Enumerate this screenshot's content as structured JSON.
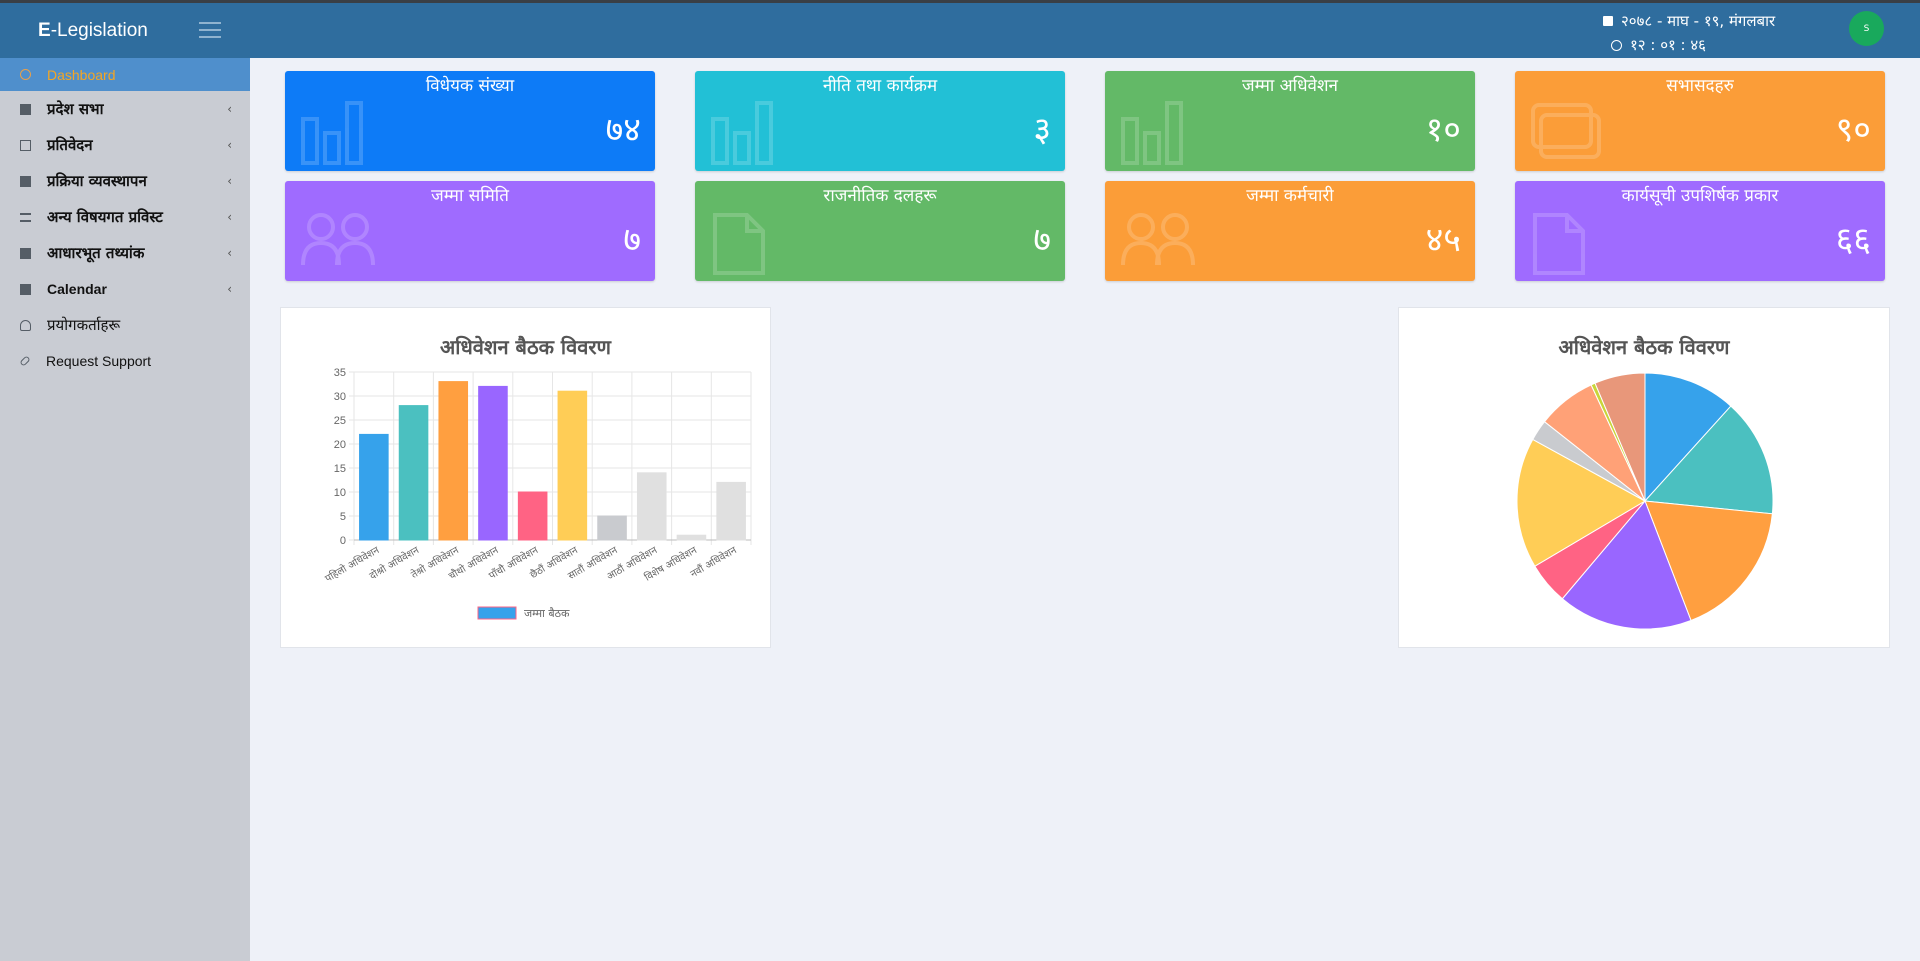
{
  "app": {
    "brand_prefix": "E",
    "brand_rest": "-Legislation"
  },
  "topbar": {
    "date": "२०७८ - माघ - १९, मंगलबार",
    "time": "१२ : ०१ : ४६",
    "user_initial": "S"
  },
  "sidebar": {
    "items": [
      {
        "label": "Dashboard",
        "icon": "dashboard-icon"
      },
      {
        "label": "प्रदेश सभा",
        "icon": "square-icon"
      },
      {
        "label": "प्रतिवेदन",
        "icon": "book-icon"
      },
      {
        "label": "प्रक्रिया व्यवस्थापन",
        "icon": "square-icon"
      },
      {
        "label": "अन्य विषयगत प्रविस्ट",
        "icon": "list-icon"
      },
      {
        "label": "आधारभूत तथ्यांक",
        "icon": "square-icon"
      },
      {
        "label": "Calendar",
        "icon": "square-icon"
      },
      {
        "label": "प्रयोगकर्ताहरू",
        "icon": "user-icon"
      },
      {
        "label": "Request Support",
        "icon": "link-icon"
      }
    ]
  },
  "cards": [
    {
      "title": "विधेयक संख्या",
      "value": "७४",
      "color": "#0d7bf7",
      "icon": "bar-chart-icon"
    },
    {
      "title": "नीति तथा कार्यक्रम",
      "value": "३",
      "color": "#22c0d6",
      "icon": "bar-chart-icon"
    },
    {
      "title": "जम्मा अधिवेशन",
      "value": "१०",
      "color": "#63b967",
      "icon": "bar-chart-icon"
    },
    {
      "title": "सभासदहरु",
      "value": "९०",
      "color": "#fb9d38",
      "icon": "folder-icon"
    },
    {
      "title": "जम्मा समिति",
      "value": "७",
      "color": "#9f6bff",
      "icon": "users-icon"
    },
    {
      "title": "राजनीतिक दलहरू",
      "value": "७",
      "color": "#63b967",
      "icon": "file-icon"
    },
    {
      "title": "जम्मा कर्मचारी",
      "value": "४५",
      "color": "#fb9d38",
      "icon": "users-icon"
    },
    {
      "title": "कार्यसूची उपशिर्षक प्रकार",
      "value": "६६",
      "color": "#9f6bff",
      "icon": "file-icon"
    }
  ],
  "chart_data": [
    {
      "type": "bar",
      "title": "अधिवेशन बैठक विवरण",
      "categories": [
        "पहिलो अधिवेशन",
        "दोश्रो अधिवेशन",
        "तेश्रो अधिवेशन",
        "चौथो अधिवेशन",
        "पाँचौ अधिवेशन",
        "छैठौं अधिवेशन",
        "सातौं अधिवेशन",
        "आठौं अधिवेशन",
        "विशेष अधिवेशन",
        "नवौं अधिवेशन"
      ],
      "series": [
        {
          "name": "जम्मा बैठक",
          "values": [
            22,
            28,
            33,
            32,
            10,
            31,
            5,
            14,
            1,
            12
          ]
        }
      ],
      "colors": [
        "#36a2eb",
        "#4bc0c0",
        "#ff9f40",
        "#9966ff",
        "#ff6384",
        "#ffcd56",
        "#c9cbcf",
        "#e0e0e0",
        "#e0e0e0",
        "#e0e0e0"
      ],
      "yticks": [
        "0",
        "5",
        "10",
        "15",
        "20",
        "25",
        "30",
        "35"
      ],
      "ylim": [
        0,
        35
      ],
      "grid": true,
      "legend": "bottom"
    },
    {
      "type": "pie",
      "title": "अधिवेशन बैठक विवरण",
      "values": [
        22,
        28,
        33,
        32,
        10,
        31,
        5,
        14,
        1,
        12
      ],
      "colors": [
        "#36a2eb",
        "#4bc0c0",
        "#ff9f40",
        "#9966ff",
        "#ff6384",
        "#ffcd56",
        "#c9cbcf",
        "#ffa177",
        "#c9d53a",
        "#e8977a"
      ]
    }
  ]
}
